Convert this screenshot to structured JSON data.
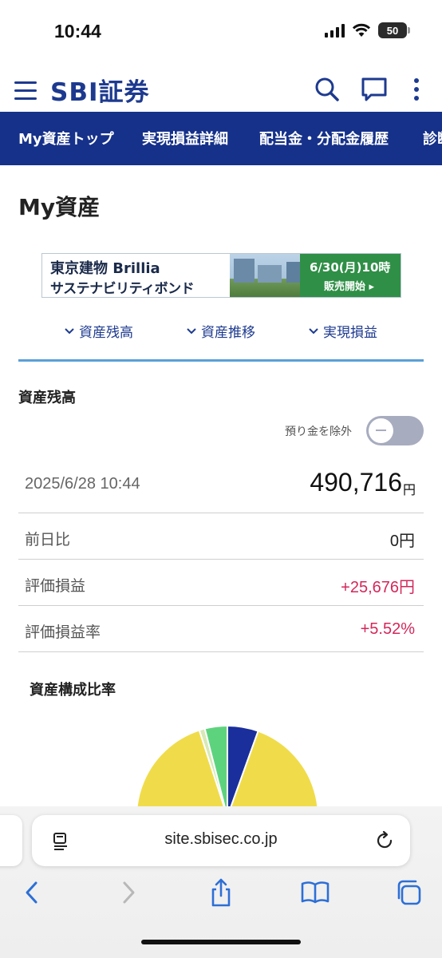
{
  "status_bar": {
    "time": "10:44",
    "battery": "50"
  },
  "header": {
    "logo": "SBI証券"
  },
  "nav": {
    "tabs": [
      "My資産トップ",
      "実現損益詳細",
      "配当金・分配金履歴",
      "診断"
    ]
  },
  "page": {
    "title": "My資産"
  },
  "banner": {
    "line1": "東京建物 Brillia",
    "line2": "サステナビリティボンド",
    "date": "6/30(月)10時",
    "sale": "販売開始 ▸"
  },
  "anchors": [
    "資産残高",
    "資産推移",
    "実現損益"
  ],
  "balance": {
    "section_title": "資産残高",
    "toggle_label": "預り金を除外",
    "toggle_on": false,
    "datetime": "2025/6/28 10:44",
    "total": "490,716",
    "unit": "円",
    "rows": [
      {
        "label": "前日比",
        "value": "0円",
        "color": "#222222"
      },
      {
        "label": "評価損益",
        "value": "+25,676円",
        "color": "#d3275a"
      },
      {
        "label": "評価損益率",
        "value": "+5.52%",
        "color": "#d3275a"
      }
    ]
  },
  "composition": {
    "title": "資産構成比率",
    "slices": [
      {
        "share": 0.055,
        "color": "#1a2f9c"
      },
      {
        "share": 0.895,
        "color": "#f0dc4a"
      },
      {
        "share": 0.01,
        "color": "#d7e8b5"
      },
      {
        "share": 0.04,
        "color": "#5ed37e"
      }
    ]
  },
  "browser": {
    "url": "site.sbisec.co.jp"
  },
  "colors": {
    "brand": "#16318a",
    "accent_blue": "#1d3a8f",
    "gain": "#d3275a"
  }
}
